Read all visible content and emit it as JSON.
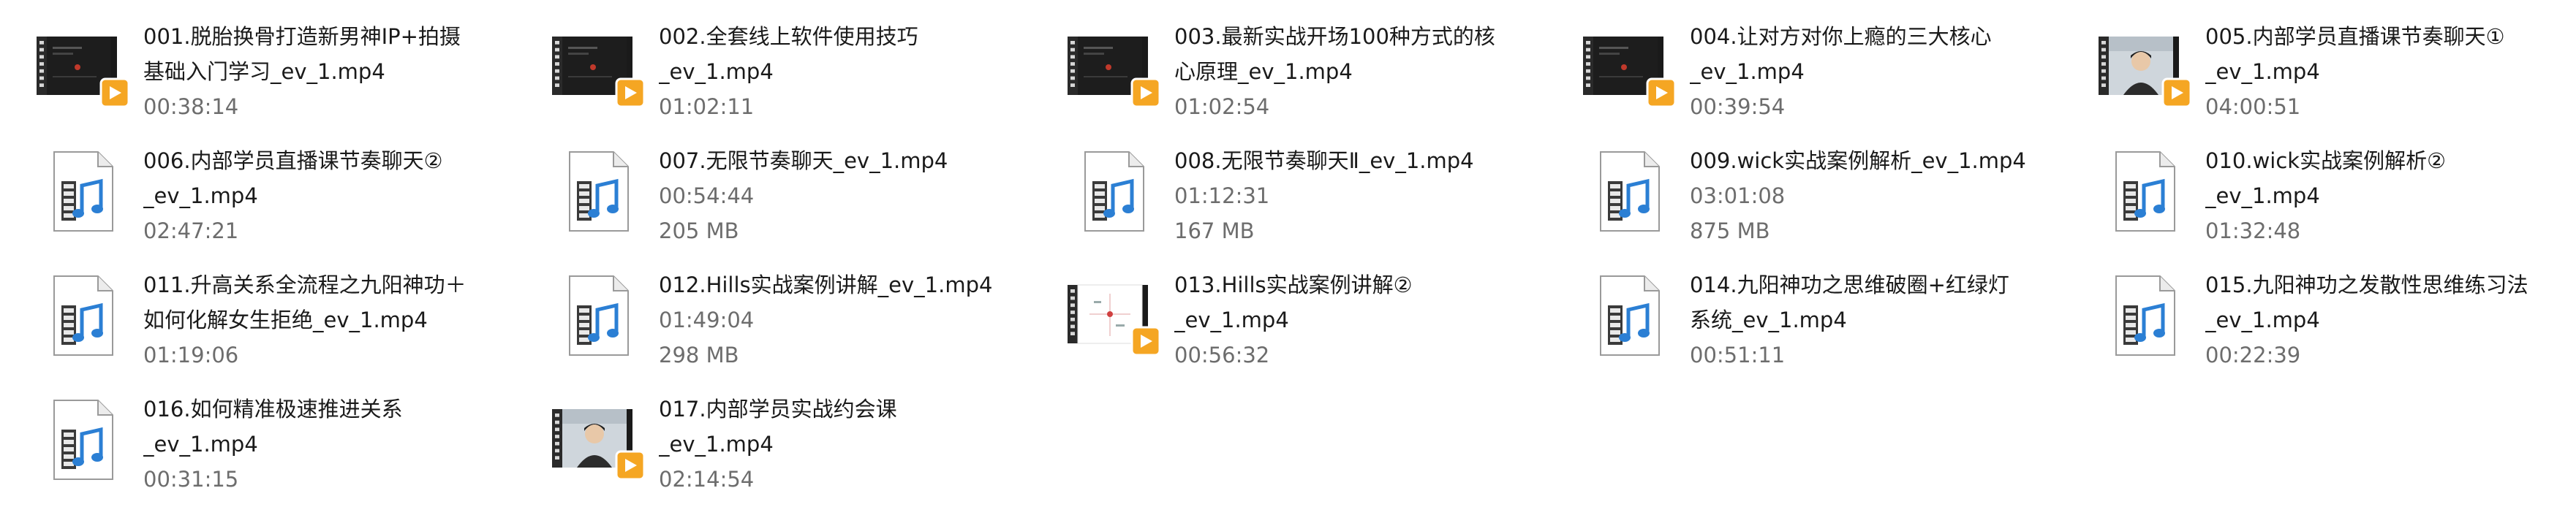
{
  "window": {
    "view": "Tiles"
  },
  "files": [
    {
      "line1": "001.脱胎换骨打造新男神IP+拍摄",
      "line2": "基础入门学习_ev_1.mp4",
      "duration": "00:38:14",
      "size": "",
      "thumb": "video-frame",
      "theme": "dark-slides"
    },
    {
      "line1": "002.全套线上软件使用技巧",
      "line2": "_ev_1.mp4",
      "duration": "01:02:11",
      "size": "",
      "thumb": "video-frame",
      "theme": "dark-slides"
    },
    {
      "line1": "003.最新实战开场100种方式的核",
      "line2": "心原理_ev_1.mp4",
      "duration": "01:02:54",
      "size": "",
      "thumb": "video-frame",
      "theme": "dark-slides"
    },
    {
      "line1": "004.让对方对你上瘾的三大核心",
      "line2": "_ev_1.mp4",
      "duration": "00:39:54",
      "size": "",
      "thumb": "video-frame",
      "theme": "dark-slides"
    },
    {
      "line1": "005.内部学员直播课节奏聊天①",
      "line2": "_ev_1.mp4",
      "duration": "04:00:51",
      "size": "",
      "thumb": "video-frame",
      "theme": "person-light"
    },
    {
      "line1": "006.内部学员直播课节奏聊天②",
      "line2": "_ev_1.mp4",
      "duration": "02:47:21",
      "size": "",
      "thumb": "media-file-icon",
      "theme": ""
    },
    {
      "line1": "007.无限节奏聊天_ev_1.mp4",
      "line2": "",
      "duration": "00:54:44",
      "size": "205 MB",
      "thumb": "media-file-icon",
      "theme": ""
    },
    {
      "line1": "008.无限节奏聊天Ⅱ_ev_1.mp4",
      "line2": "",
      "duration": "01:12:31",
      "size": "167 MB",
      "thumb": "media-file-icon",
      "theme": ""
    },
    {
      "line1": "009.wick实战案例解析_ev_1.mp4",
      "line2": "",
      "duration": "03:01:08",
      "size": "875 MB",
      "thumb": "media-file-icon",
      "theme": ""
    },
    {
      "line1": "010.wick实战案例解析②",
      "line2": "_ev_1.mp4",
      "duration": "01:32:48",
      "size": "",
      "thumb": "media-file-icon",
      "theme": ""
    },
    {
      "line1": "011.升高关系全流程之九阳神功＋",
      "line2": "如何化解女生拒绝_ev_1.mp4",
      "duration": "01:19:06",
      "size": "",
      "thumb": "media-file-icon",
      "theme": ""
    },
    {
      "line1": "012.Hills实战案例讲解_ev_1.mp4",
      "line2": "",
      "duration": "01:49:04",
      "size": "298 MB",
      "thumb": "media-file-icon",
      "theme": ""
    },
    {
      "line1": "013.Hills实战案例讲解②",
      "line2": "_ev_1.mp4",
      "duration": "00:56:32",
      "size": "",
      "thumb": "video-frame",
      "theme": "white-slide"
    },
    {
      "line1": "014.九阳神功之思维破圈+红绿灯",
      "line2": "系统_ev_1.mp4",
      "duration": "00:51:11",
      "size": "",
      "thumb": "media-file-icon",
      "theme": ""
    },
    {
      "line1": "015.九阳神功之发散性思维练习法",
      "line2": "_ev_1.mp4",
      "duration": "00:22:39",
      "size": "",
      "thumb": "media-file-icon",
      "theme": ""
    },
    {
      "line1": "016.如何精准极速推进关系",
      "line2": "_ev_1.mp4",
      "duration": "00:31:15",
      "size": "",
      "thumb": "media-file-icon",
      "theme": ""
    },
    {
      "line1": "017.内部学员实战约会课",
      "line2": "_ev_1.mp4",
      "duration": "02:14:54",
      "size": "",
      "thumb": "video-frame",
      "theme": "person-light"
    }
  ],
  "colors": {
    "text_primary": "#1a1a1a",
    "text_secondary": "#6d6d6d",
    "play_badge": "#f5a623",
    "audio_note": "#2b7fd4"
  }
}
